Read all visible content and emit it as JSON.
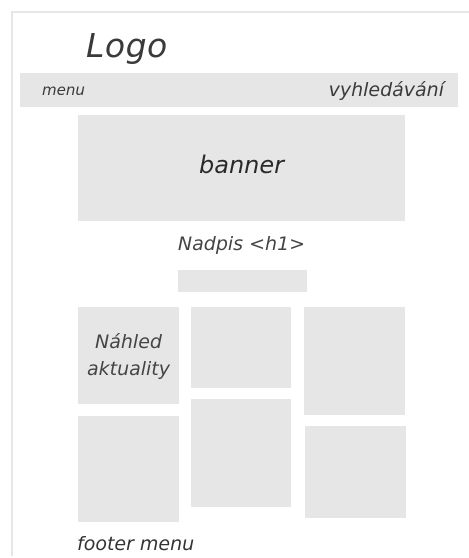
{
  "header": {
    "logo": "Logo"
  },
  "navbar": {
    "menu_label": "menu",
    "search_label": "vyhledávání"
  },
  "banner": {
    "label": "banner"
  },
  "content": {
    "heading": "Nadpis <h1>",
    "tiles": [
      {
        "label_line1": "Náhled",
        "label_line2": "aktuality"
      },
      {
        "label_line1": "",
        "label_line2": ""
      },
      {
        "label_line1": "",
        "label_line2": ""
      },
      {
        "label_line1": "",
        "label_line2": ""
      },
      {
        "label_line1": "",
        "label_line2": ""
      },
      {
        "label_line1": "",
        "label_line2": ""
      }
    ]
  },
  "footer": {
    "menu_label": "footer menu"
  }
}
